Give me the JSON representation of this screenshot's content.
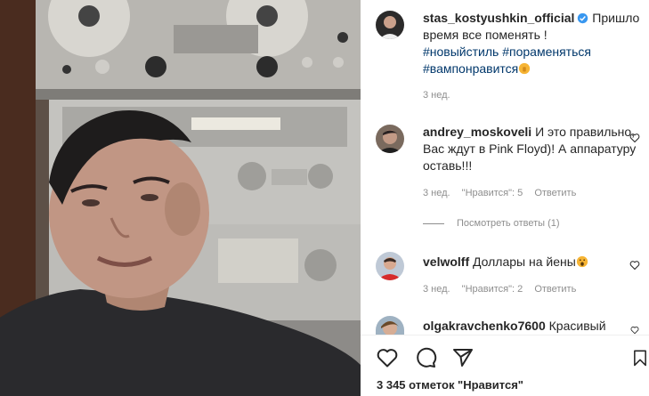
{
  "post": {
    "username": "stas_kostyushkin_official",
    "caption_text": "Пришло время все поменять !",
    "hashtags": [
      "#новыйстиль",
      "#пораменяться",
      "#вампонравится"
    ],
    "time": "3 нед."
  },
  "comments": [
    {
      "username": "andrey_moskoveli",
      "text": "И это правильно, Вас ждут в Pink Floyd)! А аппаратуру оставь!!!",
      "time": "3 нед.",
      "likes": "\"Нравится\": 5",
      "reply": "Ответить",
      "view_replies": "Посмотреть ответы (1)"
    },
    {
      "username": "velwolff",
      "text": "Доллары на йены",
      "time": "3 нед.",
      "likes": "\"Нравится\": 2",
      "reply": "Ответить"
    },
    {
      "username": "olgakravchenko7600",
      "text": "Красивый"
    }
  ],
  "footer": {
    "likes": "3 345 отметок \"Нравится\""
  },
  "icons": {
    "like": "heart-icon",
    "comment": "comment-icon",
    "share": "paper-plane-icon",
    "save": "bookmark-icon",
    "verified": "verified-badge-icon",
    "emoji": "emoji-icon"
  },
  "colors": {
    "link": "#00376b",
    "muted": "#8e8e8e",
    "verified": "#3897f0"
  }
}
